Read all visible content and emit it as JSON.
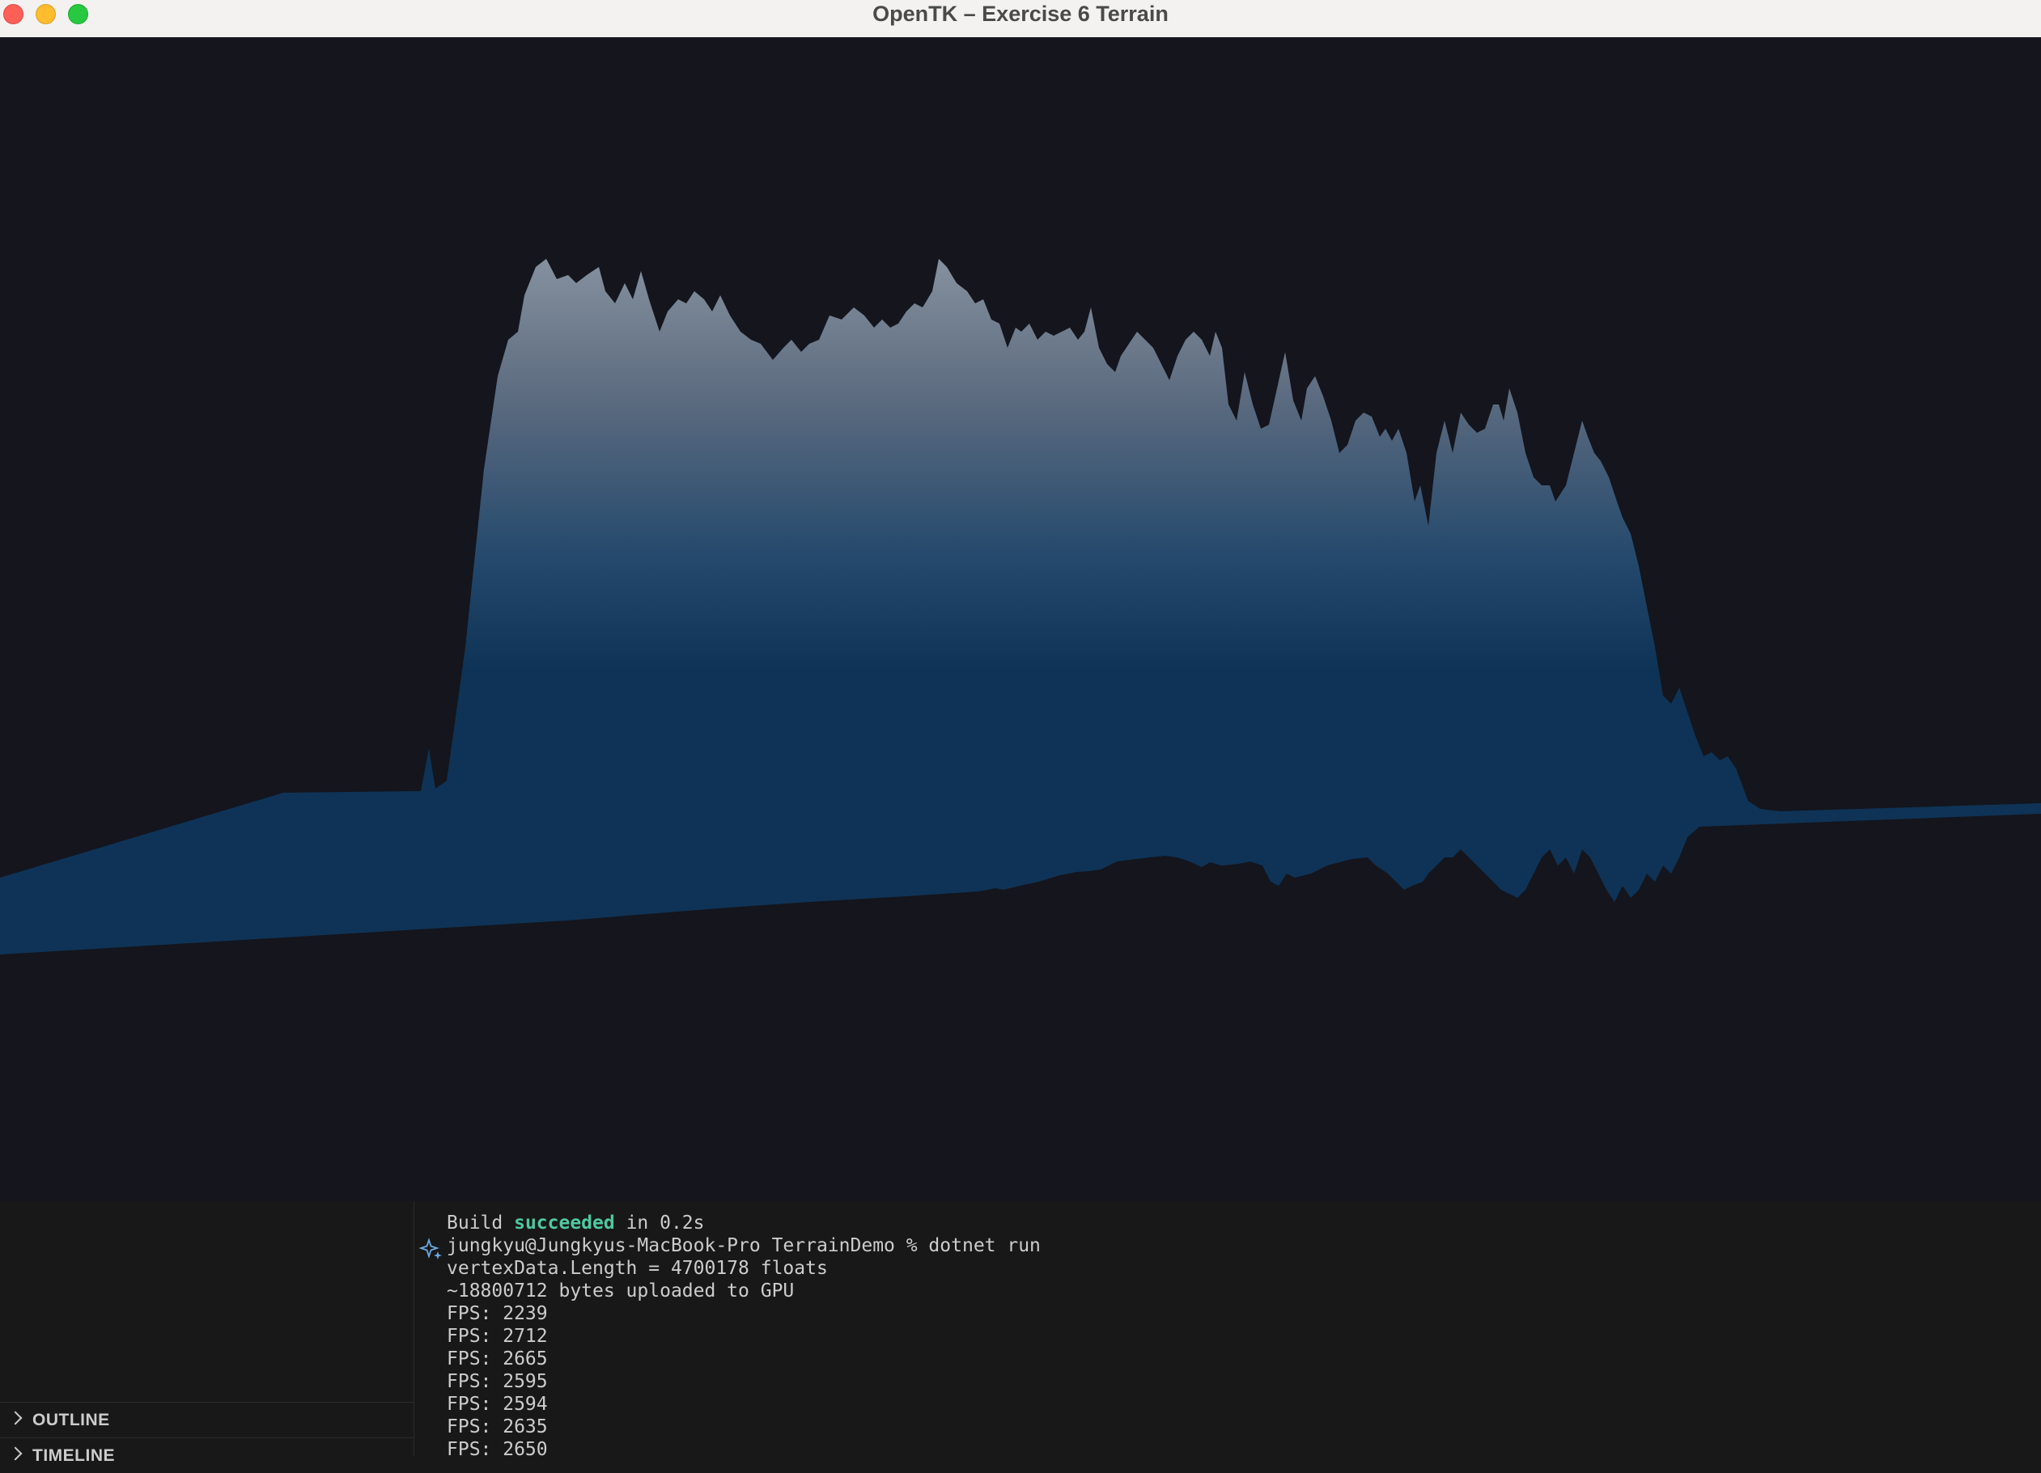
{
  "window": {
    "title": "OpenTK – Exercise 6 Terrain"
  },
  "colors": {
    "viewport_background": "#14151d",
    "terrain_base": "#0e3356",
    "terrain_peak": "#8a95a2",
    "success_text": "#4ec9a0"
  },
  "sidebar": {
    "sections": [
      {
        "label": "OUTLINE"
      },
      {
        "label": "TIMELINE"
      }
    ]
  },
  "terminal": {
    "build_prefix": "Build ",
    "build_status": "succeeded",
    "build_suffix": " in 0.2s",
    "prompt_line": "jungkyu@Jungkyus-MacBook-Pro TerrainDemo % dotnet run",
    "output_lines": [
      "vertexData.Length = 4700178 floats",
      "~18800712 bytes uploaded to GPU",
      "FPS: 2239",
      "FPS: 2712",
      "FPS: 2665",
      "FPS: 2595",
      "FPS: 2594",
      "FPS: 2635",
      "FPS: 2650"
    ]
  }
}
